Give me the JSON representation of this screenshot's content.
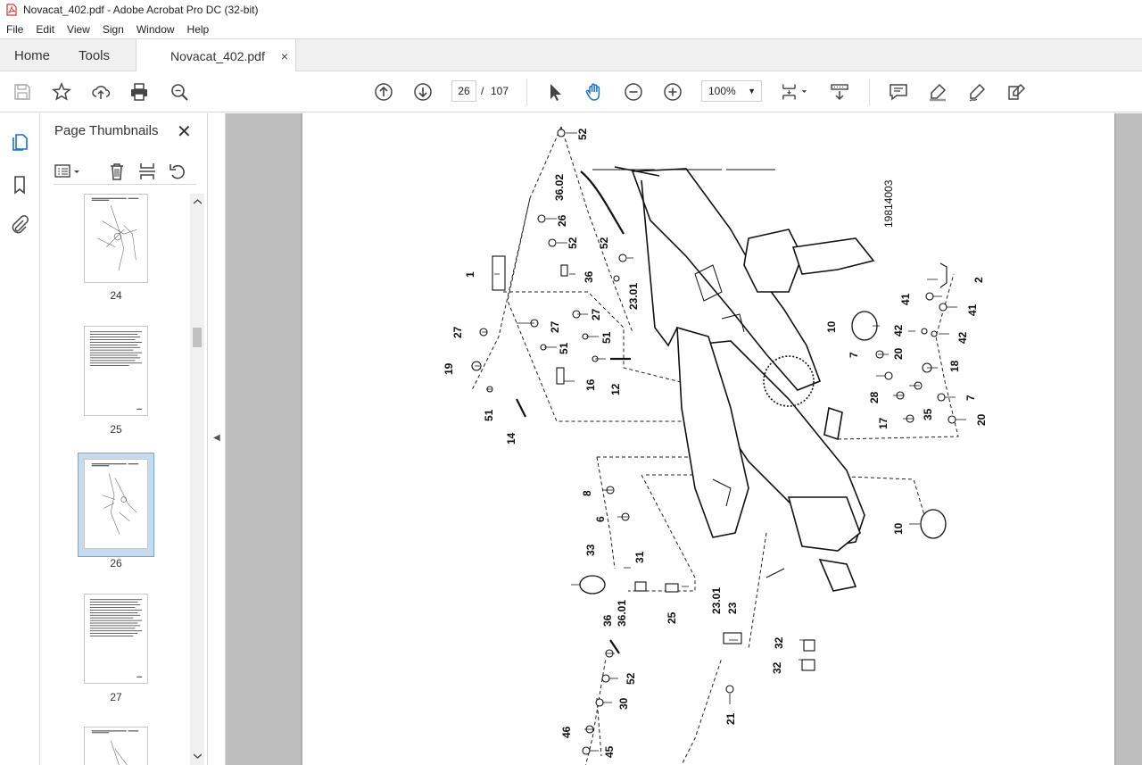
{
  "window": {
    "title": "Novacat_402.pdf - Adobe Acrobat Pro DC (32-bit)"
  },
  "menu": {
    "items": [
      "File",
      "Edit",
      "View",
      "Sign",
      "Window",
      "Help"
    ]
  },
  "tabs": {
    "home": "Home",
    "tools": "Tools",
    "document": "Novacat_402.pdf",
    "close": "×"
  },
  "toolbar": {
    "page_current": "26",
    "page_separator": "/",
    "page_total": "107",
    "zoom": "100%",
    "icons": [
      "save-icon",
      "bookmark-star-icon",
      "upload-icon",
      "print-icon",
      "find-icon",
      "prev-page-icon",
      "next-page-icon",
      "select-arrow-icon",
      "hand-icon",
      "zoom-out-icon",
      "zoom-in-icon",
      "fit-page-icon",
      "scroll-mode-icon",
      "comment-icon",
      "highlight-icon",
      "draw-icon",
      "fill-sign-icon"
    ]
  },
  "left_rail": {
    "icons": [
      "pages-icon",
      "bookmarks-icon",
      "attachments-icon"
    ]
  },
  "panel": {
    "title": "Page Thumbnails",
    "close": "✕",
    "thumbnails": [
      {
        "label": "24",
        "selected": false
      },
      {
        "label": "25",
        "selected": false
      },
      {
        "label": "26",
        "selected": true
      },
      {
        "label": "27",
        "selected": false
      }
    ]
  },
  "drawing": {
    "ref_number": "19814003",
    "callouts": [
      "52",
      "36.02",
      "26",
      "52",
      "52",
      "36",
      "23.01",
      "1",
      "27",
      "27",
      "27",
      "51",
      "51",
      "19",
      "51",
      "14",
      "16",
      "12",
      "2",
      "41",
      "41",
      "10",
      "42",
      "42",
      "7",
      "20",
      "18",
      "28",
      "35",
      "7",
      "17",
      "20",
      "8",
      "6",
      "10",
      "33",
      "31",
      "36.01",
      "36",
      "25",
      "23.01",
      "23",
      "32",
      "32",
      "52",
      "30",
      "21",
      "46",
      "45"
    ]
  }
}
